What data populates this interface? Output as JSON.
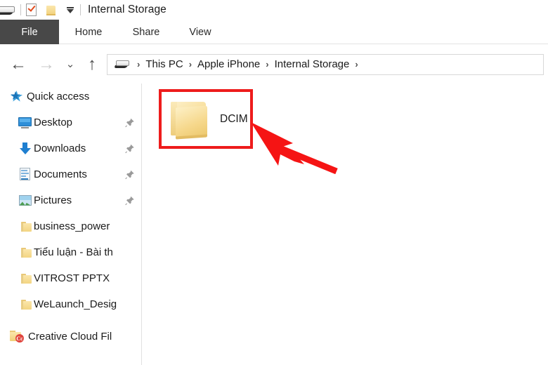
{
  "window": {
    "title": "Internal Storage"
  },
  "quick_access_toolbar": {
    "items": [
      {
        "name": "device-icon",
        "label": ""
      },
      {
        "name": "properties-icon",
        "label": ""
      },
      {
        "name": "new-folder-icon",
        "label": ""
      },
      {
        "name": "customize-dropdown-icon",
        "label": ""
      }
    ]
  },
  "ribbon": {
    "tabs": [
      {
        "id": "file",
        "label": "File",
        "active": true
      },
      {
        "id": "home",
        "label": "Home",
        "active": false
      },
      {
        "id": "share",
        "label": "Share",
        "active": false
      },
      {
        "id": "view",
        "label": "View",
        "active": false
      }
    ]
  },
  "navigation": {
    "back_label": "←",
    "forward_label": "→",
    "recent_label": "⌄",
    "up_label": "↑",
    "breadcrumbs": [
      {
        "label": "This PC"
      },
      {
        "label": "Apple iPhone"
      },
      {
        "label": "Internal Storage"
      }
    ],
    "separator": "›"
  },
  "sidebar": {
    "items": [
      {
        "id": "quick-access",
        "label": "Quick access",
        "icon": "star-icon",
        "pinned": false,
        "indent": "root"
      },
      {
        "id": "desktop",
        "label": "Desktop",
        "icon": "monitor-icon",
        "pinned": true,
        "indent": "child"
      },
      {
        "id": "downloads",
        "label": "Downloads",
        "icon": "download-arrow-icon",
        "pinned": true,
        "indent": "child"
      },
      {
        "id": "documents",
        "label": "Documents",
        "icon": "document-icon",
        "pinned": true,
        "indent": "child"
      },
      {
        "id": "pictures",
        "label": "Pictures",
        "icon": "picture-icon",
        "pinned": true,
        "indent": "child"
      },
      {
        "id": "business",
        "label": "business_power",
        "icon": "folder-icon",
        "pinned": false,
        "indent": "child"
      },
      {
        "id": "tieu-luan",
        "label": "Tiểu luận - Bài th",
        "icon": "folder-icon",
        "pinned": false,
        "indent": "child"
      },
      {
        "id": "vitrost",
        "label": "VITROST PPTX",
        "icon": "folder-icon",
        "pinned": false,
        "indent": "child"
      },
      {
        "id": "welaunch",
        "label": "WeLaunch_Desig",
        "icon": "folder-icon",
        "pinned": false,
        "indent": "child"
      },
      {
        "id": "creative",
        "label": "Creative Cloud Fil",
        "icon": "creative-cloud-folder-icon",
        "pinned": false,
        "indent": "root"
      }
    ]
  },
  "content": {
    "items": [
      {
        "id": "dcim",
        "label": "DCIM",
        "icon": "folder-icon",
        "highlighted": true
      }
    ]
  },
  "annotations": {
    "highlight_color": "#ee1c1c",
    "arrow_color": "#f51414",
    "arrow_target": "DCIM"
  }
}
